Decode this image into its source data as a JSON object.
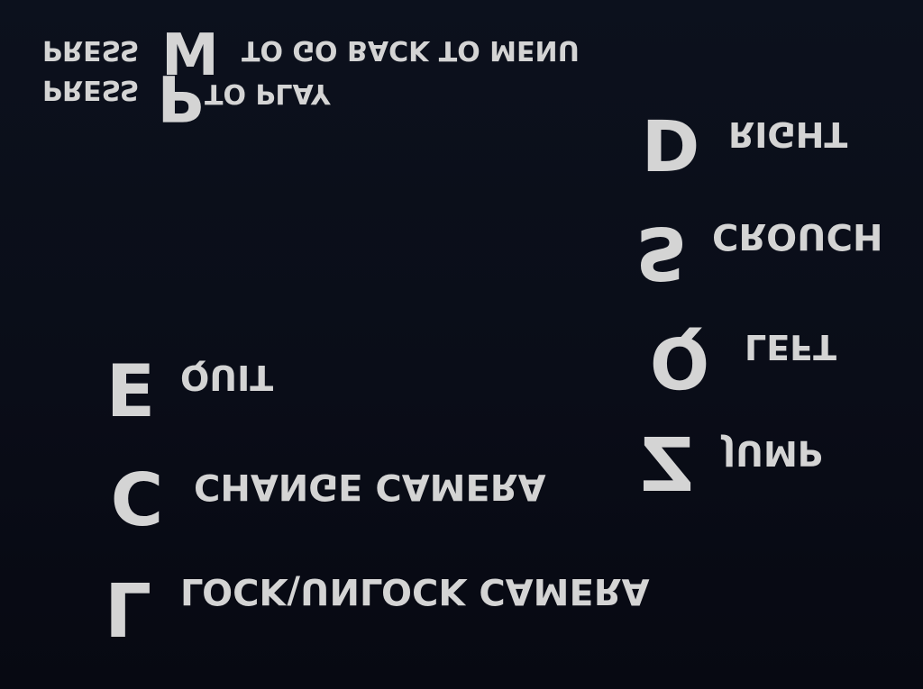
{
  "header": {
    "press_label_1": "PRESS",
    "menu_key": "M",
    "menu_text": "TO GO BACK TO MENU",
    "press_label_2": "PRESS",
    "play_key": "P",
    "play_text": "TO PLAY"
  },
  "controls": {
    "right": {
      "key": "D",
      "label": "RIGHT"
    },
    "crouch": {
      "key": "S",
      "label": "CROUCH"
    },
    "left": {
      "key": "Q",
      "label": "LEFT"
    },
    "jump": {
      "key": "Z",
      "label": "JUMP"
    },
    "quit": {
      "key": "E",
      "label": "QUIT"
    },
    "change_camera": {
      "key": "C",
      "label": "CHANGE CAMERA"
    },
    "lock_camera": {
      "key": "L",
      "label": "LOCK\\UNLOCK CAMERA"
    }
  },
  "colors": {
    "text": "#d4d4d4",
    "background_top": "#0c111d",
    "background_bottom": "#070912"
  }
}
